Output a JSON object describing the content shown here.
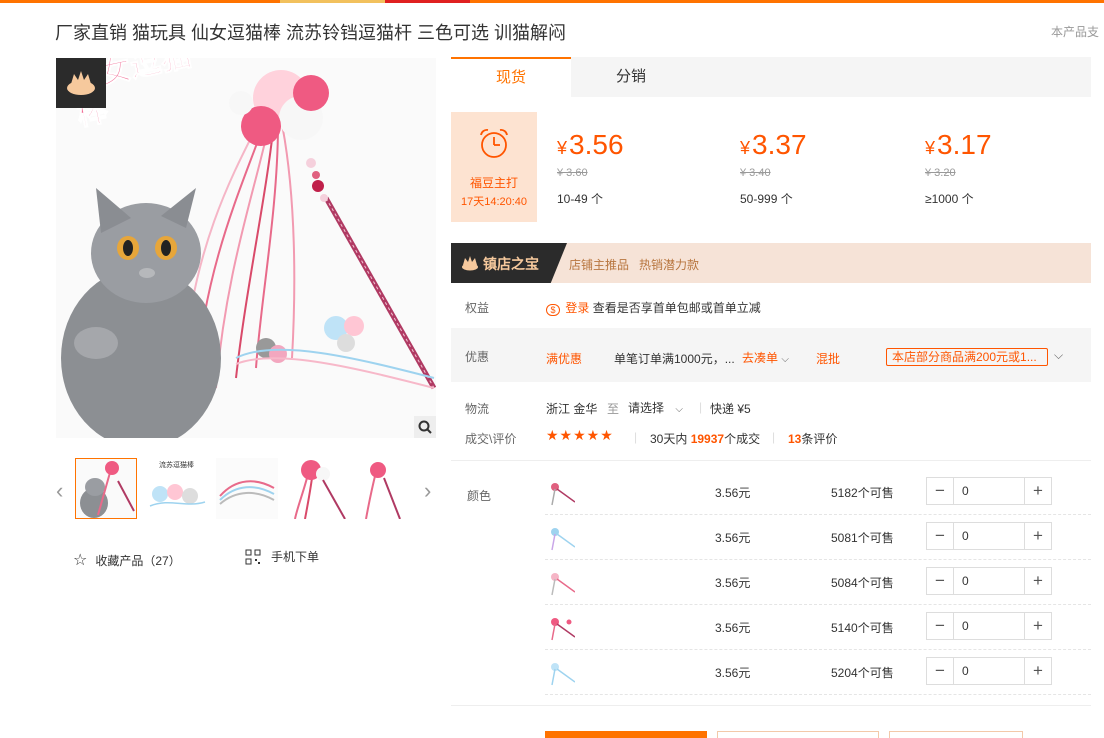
{
  "product": {
    "title": "厂家直销 猫玩具 仙女逗猫棒 流苏铃铛逗猫杆 三色可选 训猫解闷",
    "support_text": "本产品支"
  },
  "gallery": {
    "image_caption": "仙女逗猫棒",
    "thumb2_caption": "流苏逗猫棒"
  },
  "actions": {
    "favorite_label": "收藏产品（27）",
    "mobile_order_label": "手机下单"
  },
  "tabs": [
    {
      "label": "现货"
    },
    {
      "label": "分销"
    }
  ],
  "promo": {
    "name": "福豆主打",
    "countdown": "17天14:20:40"
  },
  "price_tiers": [
    {
      "currency": "¥",
      "price": "3.56",
      "original": "¥ 3.60",
      "range": "10-49 个"
    },
    {
      "currency": "¥",
      "price": "3.37",
      "original": "¥ 3.40",
      "range": "50-999 个"
    },
    {
      "currency": "¥",
      "price": "3.17",
      "original": "¥ 3.20",
      "range": "≥1000 个"
    }
  ],
  "treasure": {
    "label": "镇店之宝",
    "subtitle": "店铺主推品   热销潜力款"
  },
  "rights": {
    "label": "权益",
    "login": "登录",
    "text": "查看是否享首单包邮或首单立减"
  },
  "discount": {
    "label": "优惠",
    "tag": "满优惠",
    "text": "单笔订单满1000元，...",
    "link": "去凑单",
    "mixed": "混批",
    "coupon": "本店部分商品满200元或1..."
  },
  "logistics": {
    "label": "物流",
    "origin": "浙江 金华",
    "to": "至",
    "select": "请选择",
    "express": "快递 ¥5"
  },
  "deals": {
    "label": "成交\\评价",
    "stars": "★★★★★",
    "prefix": "30天内",
    "count": "19937",
    "suffix": "个成交",
    "reviews": "13",
    "reviews_suffix": "条评价"
  },
  "sku": {
    "label": "颜色",
    "rows": [
      {
        "price": "3.56元",
        "stock": "5182个可售",
        "qty": "0"
      },
      {
        "price": "3.56元",
        "stock": "5081个可售",
        "qty": "0"
      },
      {
        "price": "3.56元",
        "stock": "5084个可售",
        "qty": "0"
      },
      {
        "price": "3.56元",
        "stock": "5140个可售",
        "qty": "0"
      },
      {
        "price": "3.56元",
        "stock": "5204个可售",
        "qty": "0"
      }
    ]
  },
  "colors": {
    "accent": "#ff7300",
    "price": "#ff5500",
    "promo_bg": "#fde3d1",
    "treasure_bg": "#f6e3d7"
  }
}
